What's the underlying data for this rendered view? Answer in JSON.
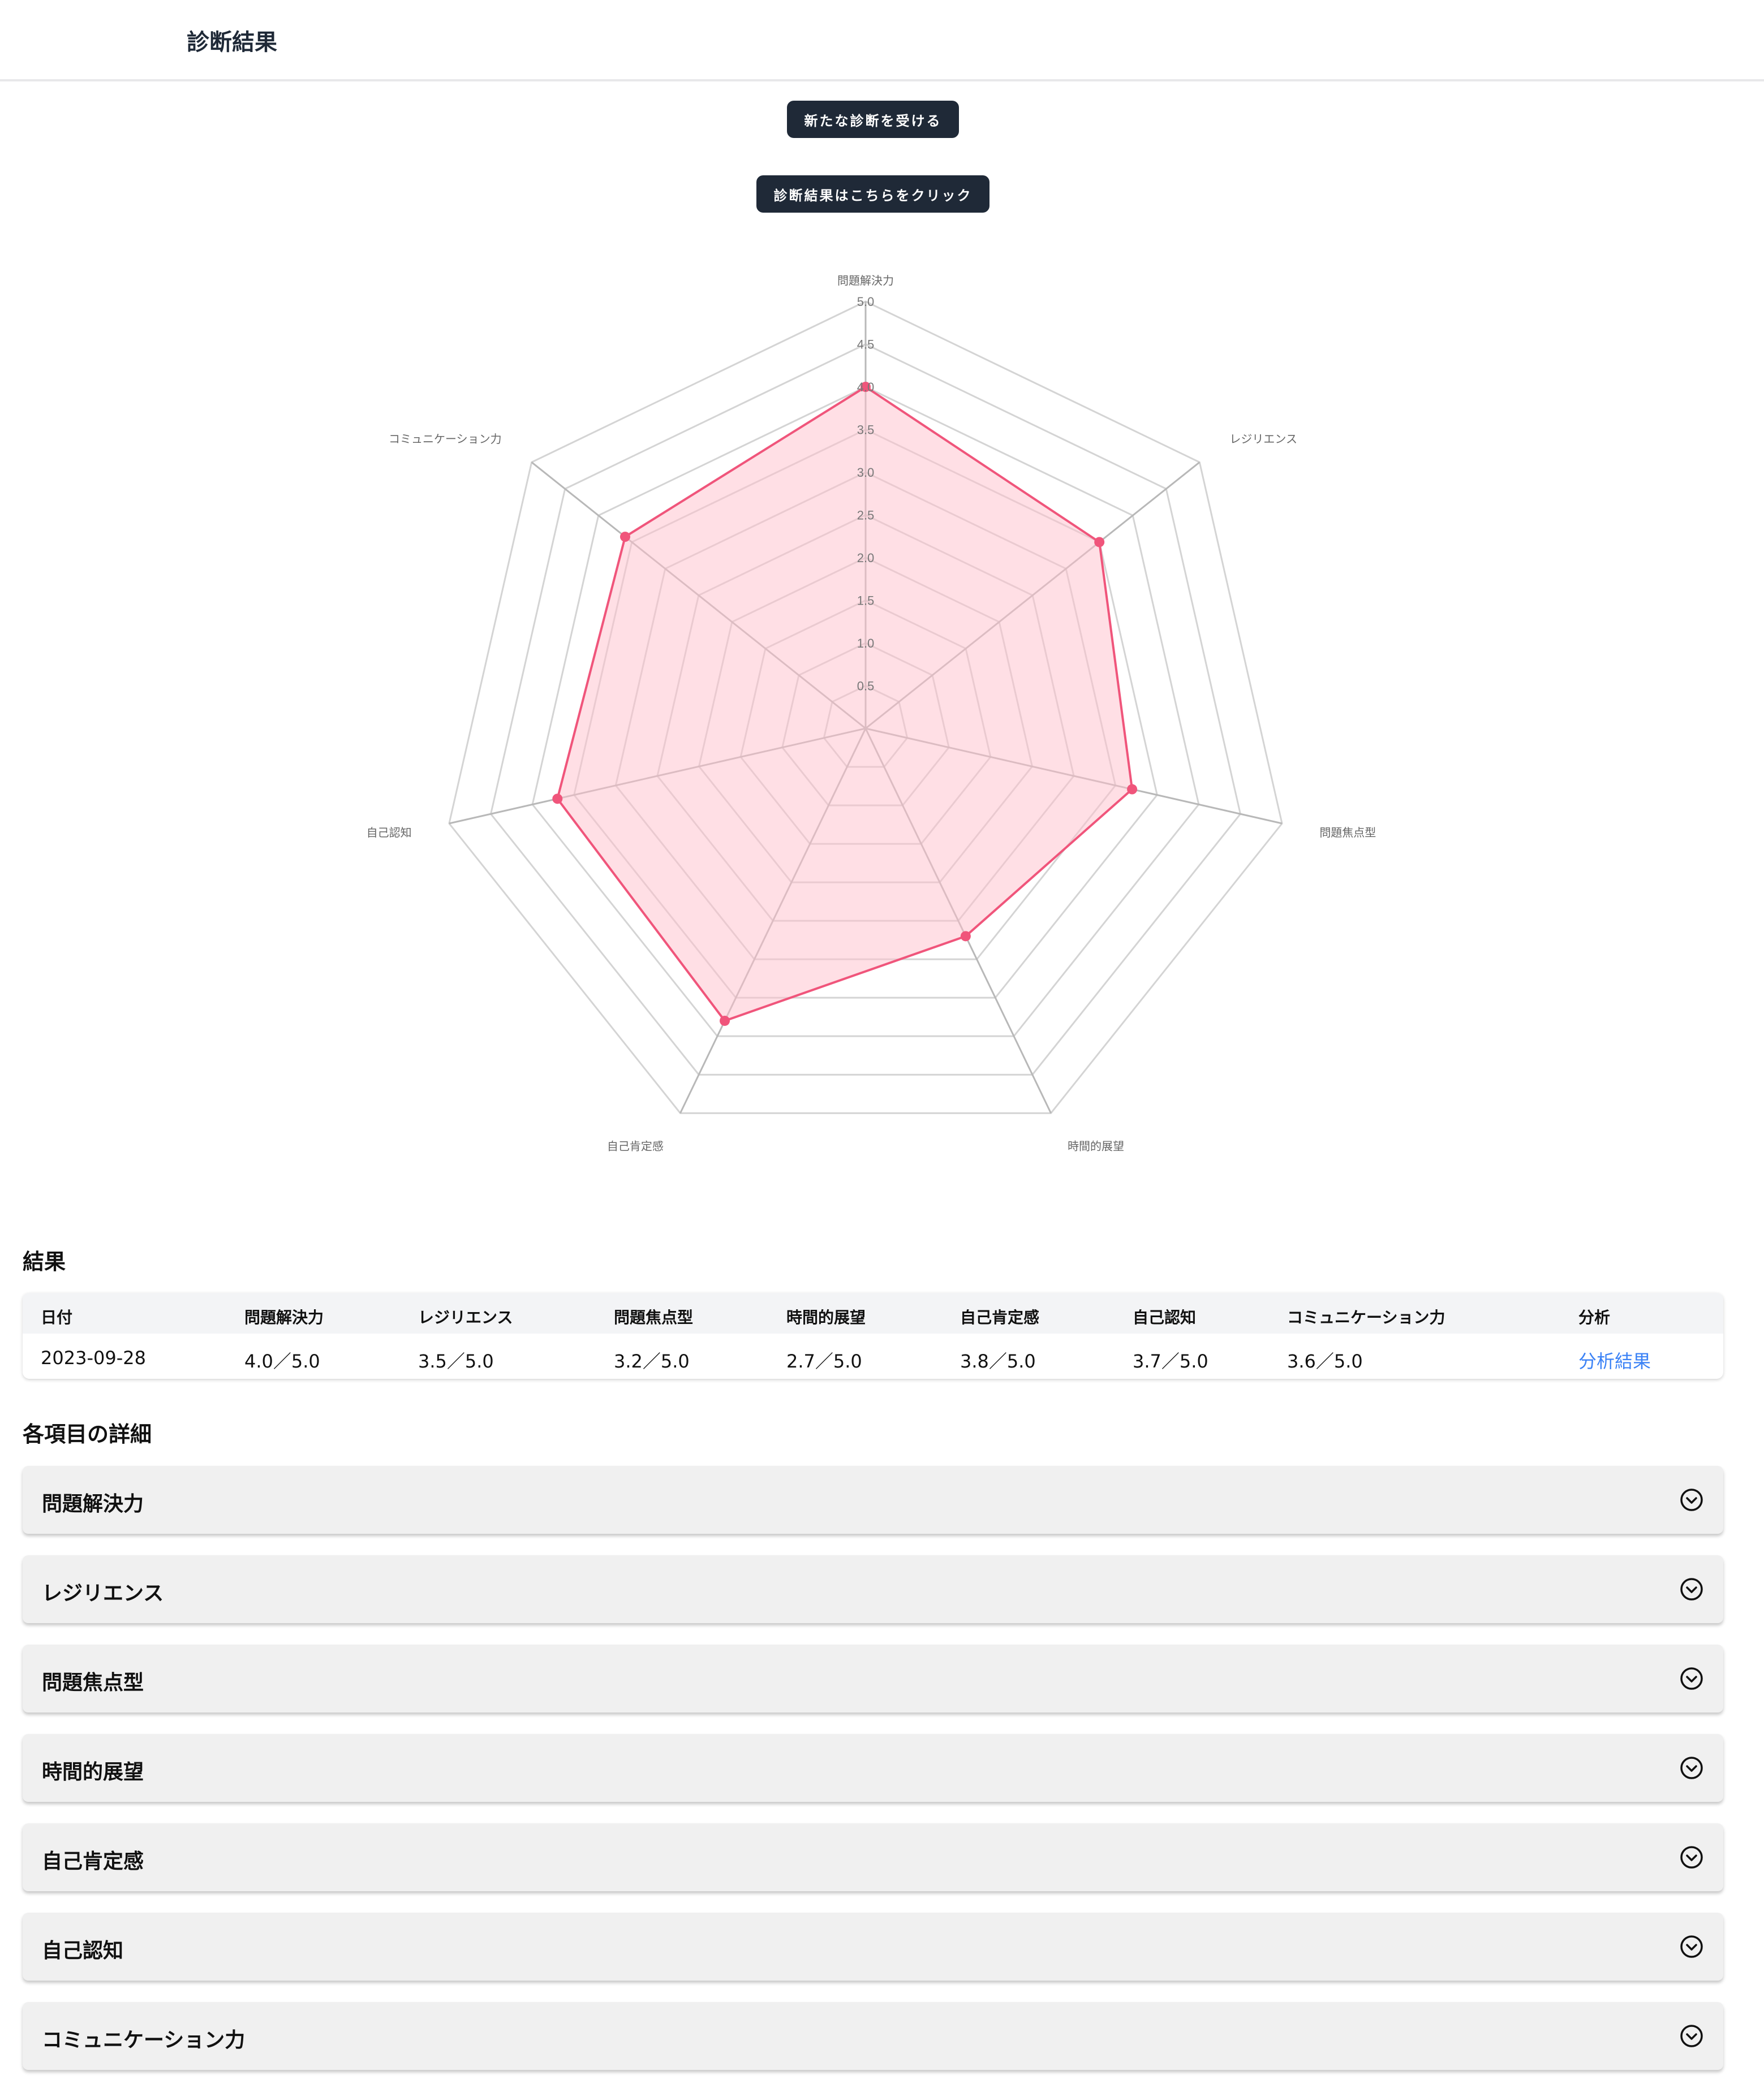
{
  "header": {
    "title": "診断結果"
  },
  "buttons": {
    "new_diagnosis": "新たな診断を受ける",
    "view_results": "診断結果はこちらをクリック"
  },
  "chart_data": {
    "type": "radar",
    "axes": [
      "問題解決力",
      "レジリエンス",
      "問題焦点型",
      "時間的展望",
      "自己肯定感",
      "自己認知",
      "コミュニケーション力"
    ],
    "values": [
      4.0,
      3.5,
      3.2,
      2.7,
      3.8,
      3.7,
      3.6
    ],
    "ticks": [
      "0.5",
      "1.0",
      "1.5",
      "2.0",
      "2.5",
      "3.0",
      "3.5",
      "4.0",
      "4.5",
      "5.0"
    ],
    "range": [
      0,
      5
    ],
    "colors": {
      "line": "#f0557b",
      "fill": "#ffc0cc",
      "grid": "#d4d4d4"
    }
  },
  "results": {
    "title": "結果",
    "headers": [
      "日付",
      "問題解決力",
      "レジリエンス",
      "問題焦点型",
      "時間的展望",
      "自己肯定感",
      "自己認知",
      "コミュニケーション力",
      "分析"
    ],
    "row": [
      "2023-09-28",
      "4.0／5.0",
      "3.5／5.0",
      "3.2／5.0",
      "2.7／5.0",
      "3.8／5.0",
      "3.7／5.0",
      "3.6／5.0",
      "分析結果"
    ]
  },
  "details": {
    "title": "各項目の詳細",
    "items": [
      "問題解決力",
      "レジリエンス",
      "問題焦点型",
      "時間的展望",
      "自己肯定感",
      "自己認知",
      "コミュニケーション力"
    ]
  }
}
